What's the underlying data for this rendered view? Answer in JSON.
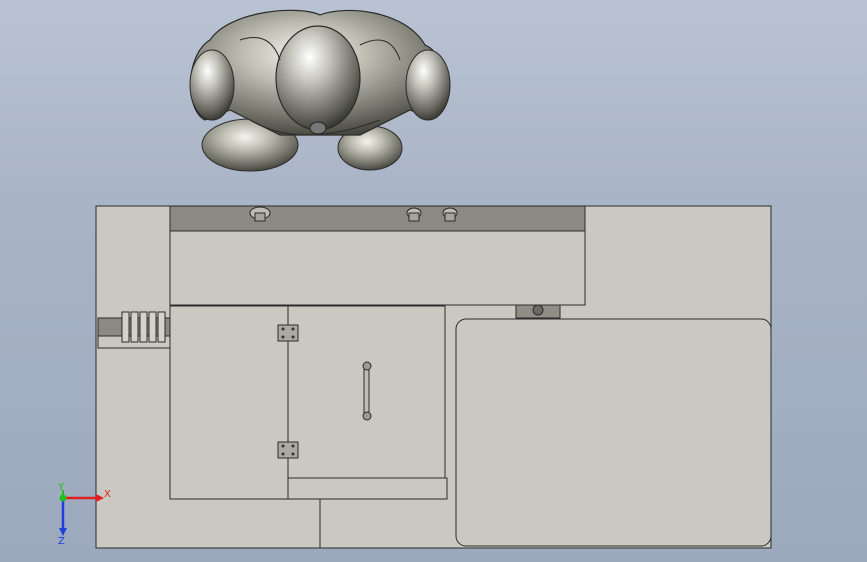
{
  "viewport": {
    "background_top": "#b9c3d3",
    "background_bottom": "#9ca9bd"
  },
  "model": {
    "body_color": "#c9c9c1",
    "edge_color": "#2b2b2b",
    "robot_color": "#9a9a8e",
    "tray_color": "#7f7f78"
  },
  "triad": {
    "x_label": "X",
    "y_label": "Y",
    "z_label": "Z",
    "x_color": "#e02020",
    "y_color": "#20c020",
    "z_color": "#2040e0"
  }
}
